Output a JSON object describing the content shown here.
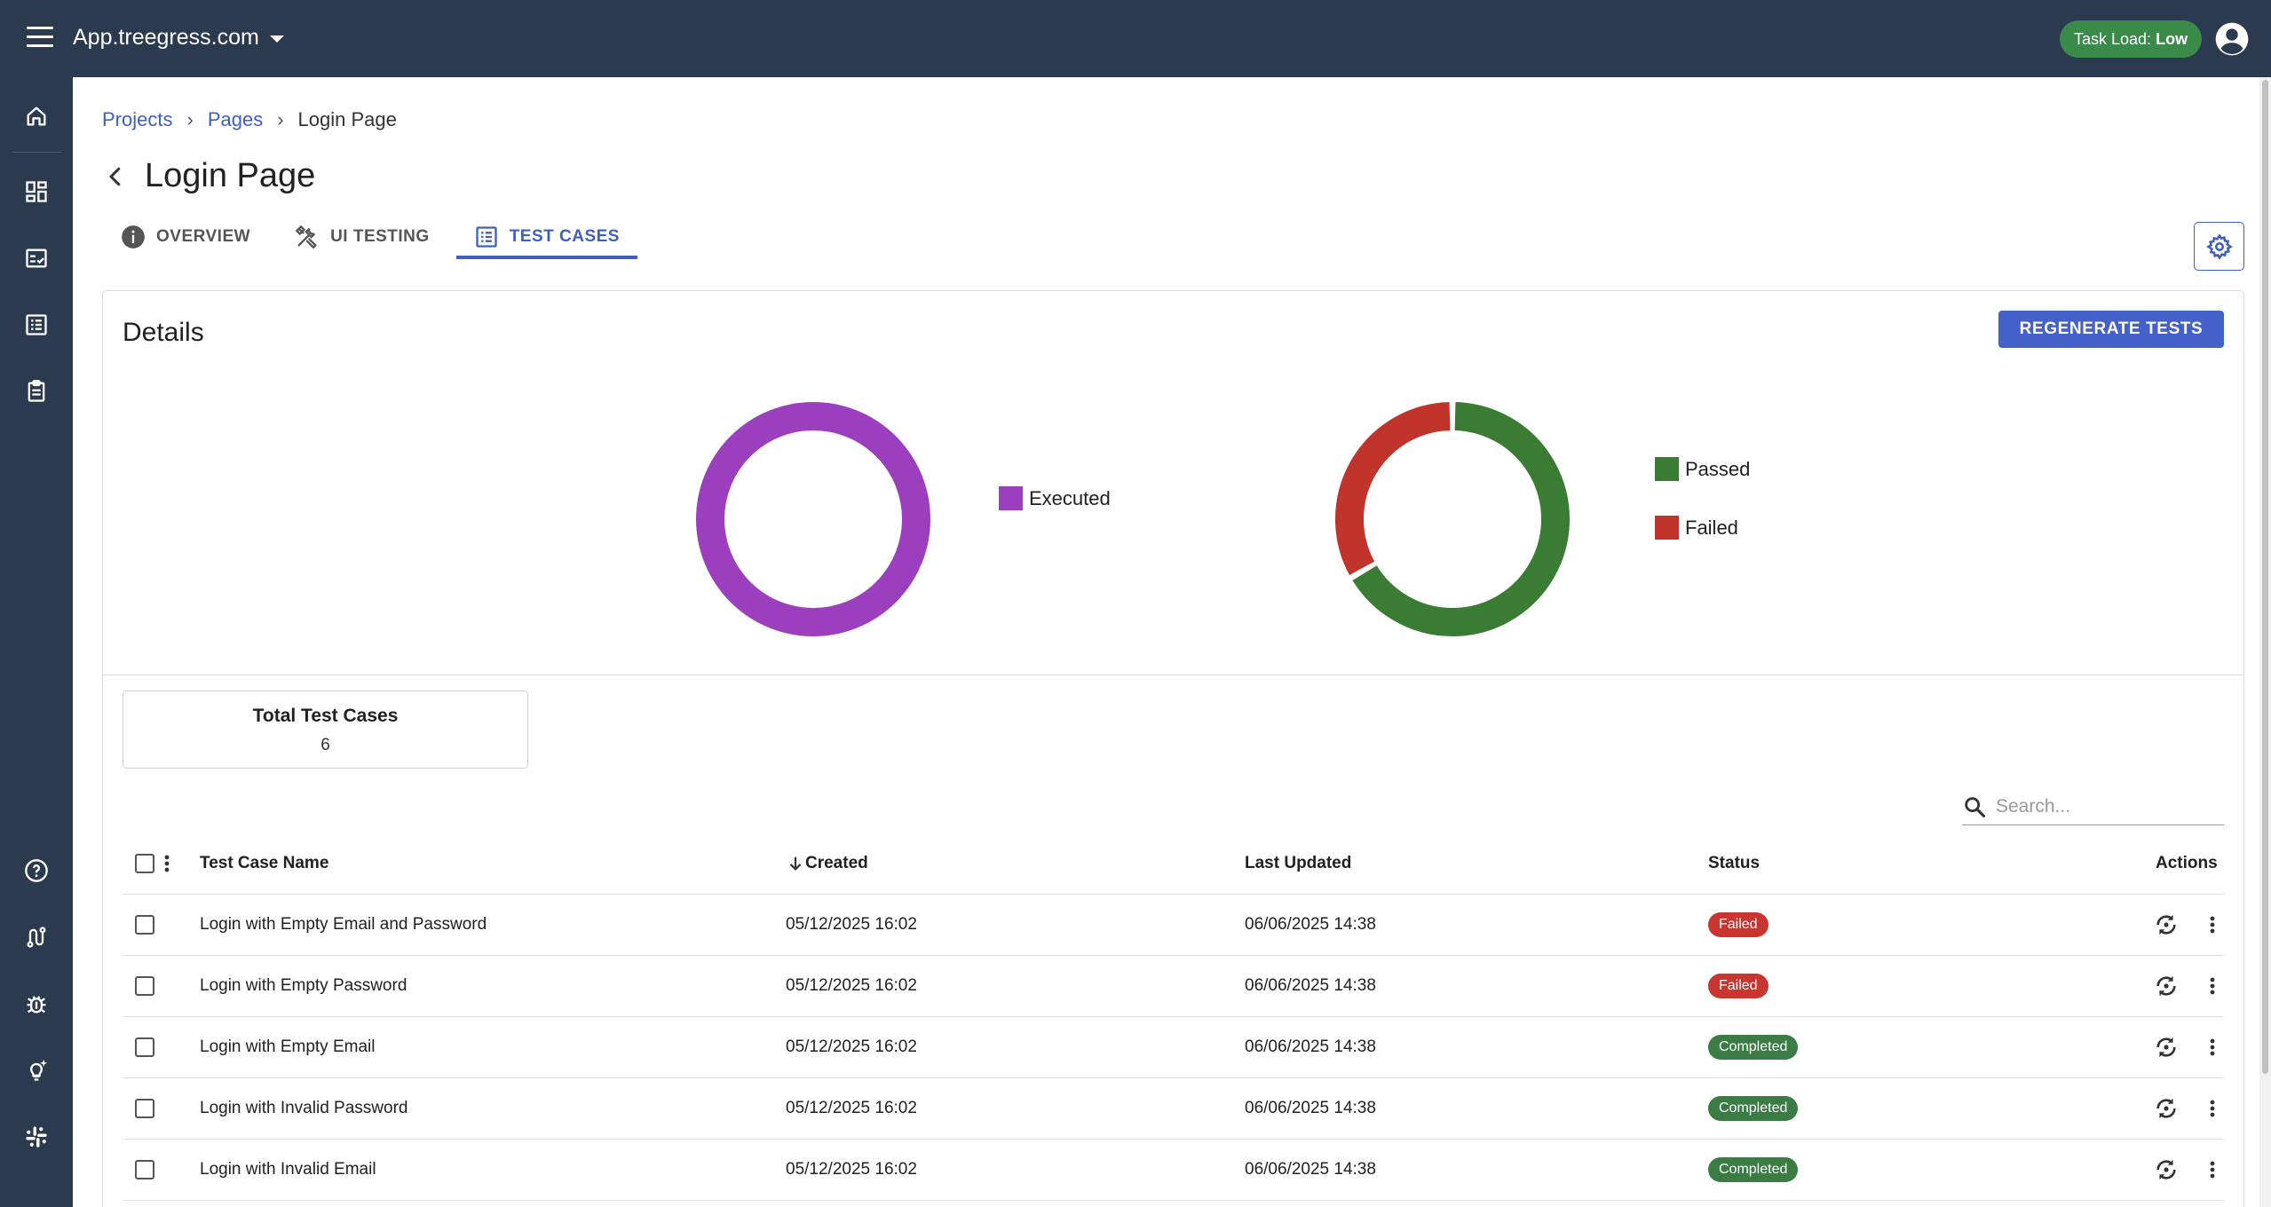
{
  "app": {
    "title": "App.treegress.com",
    "task_load_label": "Task Load:",
    "task_load_value": "Low"
  },
  "breadcrumb": {
    "projects": "Projects",
    "pages": "Pages",
    "current": "Login Page",
    "separator": "›"
  },
  "page": {
    "title": "Login Page"
  },
  "tabs": [
    {
      "label": "OVERVIEW",
      "icon": "info-icon"
    },
    {
      "label": "UI TESTING",
      "icon": "tools-icon"
    },
    {
      "label": "TEST CASES",
      "icon": "list-icon",
      "active": true
    }
  ],
  "details": {
    "title": "Details",
    "regenerate_label": "REGENERATE TESTS"
  },
  "chart_data": [
    {
      "type": "pie",
      "variant": "donut",
      "categories": [
        "Executed"
      ],
      "values": [
        6
      ],
      "colors": [
        "#9c3fbf"
      ],
      "legend": "right"
    },
    {
      "type": "pie",
      "variant": "donut",
      "categories": [
        "Passed",
        "Failed"
      ],
      "values": [
        4,
        2
      ],
      "colors": [
        "#3a7c34",
        "#c0342c"
      ],
      "legend": "right"
    }
  ],
  "summary": {
    "label": "Total Test Cases",
    "value": "6"
  },
  "search": {
    "placeholder": "Search..."
  },
  "table": {
    "headers": {
      "name": "Test Case Name",
      "created": "Created",
      "updated": "Last Updated",
      "status": "Status",
      "actions": "Actions"
    },
    "rows": [
      {
        "name": "Login with Empty Email and Password",
        "created": "05/12/2025 16:02",
        "updated": "06/06/2025 14:38",
        "status": "Failed"
      },
      {
        "name": "Login with Empty Password",
        "created": "05/12/2025 16:02",
        "updated": "06/06/2025 14:38",
        "status": "Failed"
      },
      {
        "name": "Login with Empty Email",
        "created": "05/12/2025 16:02",
        "updated": "06/06/2025 14:38",
        "status": "Completed"
      },
      {
        "name": "Login with Invalid Password",
        "created": "05/12/2025 16:02",
        "updated": "06/06/2025 14:38",
        "status": "Completed"
      },
      {
        "name": "Login with Invalid Email",
        "created": "05/12/2025 16:02",
        "updated": "06/06/2025 14:38",
        "status": "Completed"
      }
    ]
  },
  "colors": {
    "topbar": "#2b3a4e",
    "accent": "#3f5fbf",
    "failed": "#c8362f",
    "completed": "#3a7c44",
    "executed": "#9c3fbf"
  }
}
